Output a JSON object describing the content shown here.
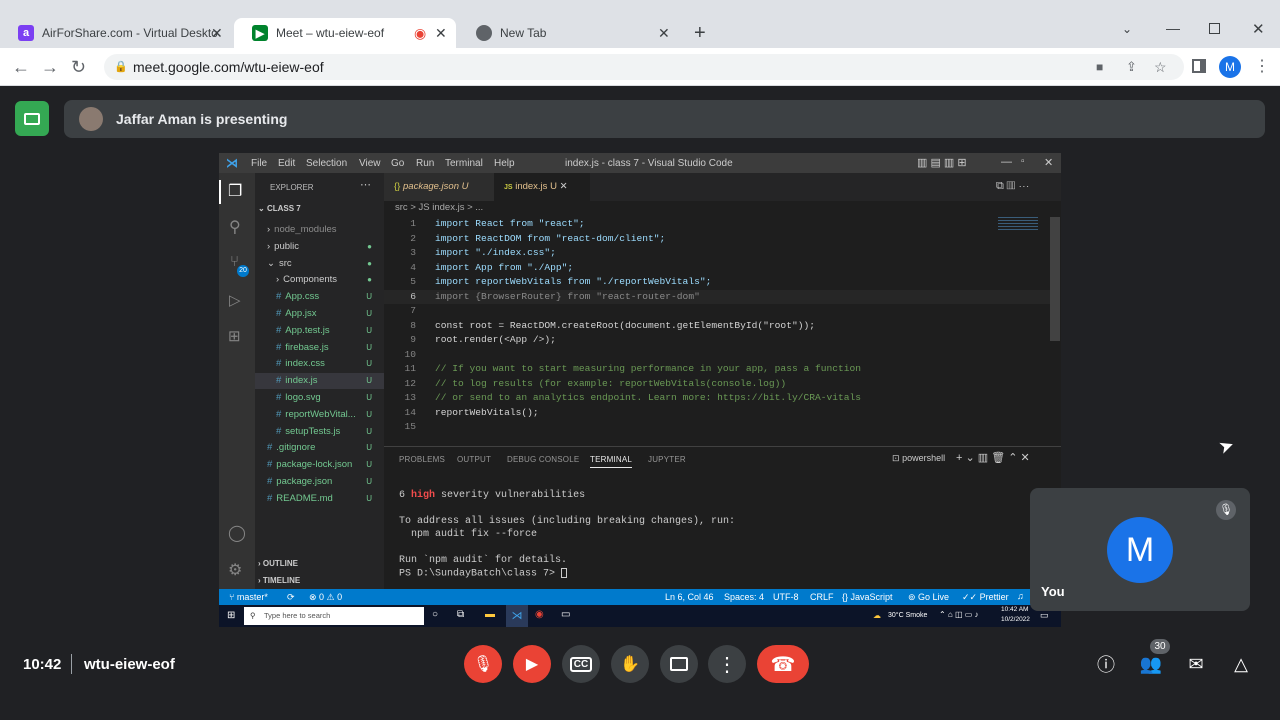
{
  "browser": {
    "tabs": [
      {
        "title": "AirForShare.com - Virtual Deskto",
        "icon": "airforshare-icon"
      },
      {
        "title": "Meet – wtu-eiew-eof",
        "icon": "meet-icon",
        "active": true
      },
      {
        "title": "New Tab",
        "icon": "chrome-icon"
      }
    ],
    "url": "meet.google.com/wtu-eiew-eof",
    "profile_initial": "M"
  },
  "meet": {
    "presenter_text": "Jaffar Aman is presenting",
    "clock": "10:42",
    "meeting_code": "wtu-eiew-eof",
    "you_label": "You",
    "you_initial": "M",
    "participants_count": "30",
    "colors": {
      "end_call": "#ea4335",
      "avatar": "#1a73e8",
      "present_icon_bg": "#34a853"
    }
  },
  "vscode": {
    "menu": [
      "File",
      "Edit",
      "Selection",
      "View",
      "Go",
      "Run",
      "Terminal",
      "Help"
    ],
    "window_title": "index.js - class 7 - Visual Studio Code",
    "explorer_header": "EXPLORER",
    "root_folder": "CLASS 7",
    "explorer": [
      {
        "name": "node_modules",
        "badge": ""
      },
      {
        "name": "public",
        "badge": "●"
      },
      {
        "name": "src",
        "badge": "●"
      },
      {
        "name": "Components",
        "badge": "●"
      },
      {
        "name": "App.css",
        "badge": "U"
      },
      {
        "name": "App.jsx",
        "badge": "U"
      },
      {
        "name": "App.test.js",
        "badge": "U"
      },
      {
        "name": "firebase.js",
        "badge": "U"
      },
      {
        "name": "index.css",
        "badge": "U"
      },
      {
        "name": "index.js",
        "badge": "U"
      },
      {
        "name": "logo.svg",
        "badge": "U"
      },
      {
        "name": "reportWebVital...",
        "badge": "U"
      },
      {
        "name": "setupTests.js",
        "badge": "U"
      },
      {
        "name": ".gitignore",
        "badge": "U"
      },
      {
        "name": "package-lock.json",
        "badge": "U"
      },
      {
        "name": "package.json",
        "badge": "U"
      },
      {
        "name": "README.md",
        "badge": "U"
      }
    ],
    "outline": "OUTLINE",
    "timeline": "TIMELINE",
    "editor_tabs": [
      {
        "label": "package.json",
        "mark": "U"
      },
      {
        "label": "index.js",
        "mark": "U"
      }
    ],
    "breadcrumb": [
      "src",
      ">",
      "JS index.js",
      "> ..."
    ],
    "code": [
      {
        "n": "1",
        "text": "import React from \"react\";"
      },
      {
        "n": "2",
        "text": "import ReactDOM from \"react-dom/client\";"
      },
      {
        "n": "3",
        "text": "import \"./index.css\";"
      },
      {
        "n": "4",
        "text": "import App from \"./App\";"
      },
      {
        "n": "5",
        "text": "import reportWebVitals from \"./reportWebVitals\";"
      },
      {
        "n": "6",
        "text": "import {BrowserRouter} from \"react-router-dom\""
      },
      {
        "n": "7",
        "text": ""
      },
      {
        "n": "8",
        "text": "const root = ReactDOM.createRoot(document.getElementById(\"root\"));"
      },
      {
        "n": "9",
        "text": "root.render(<App />);"
      },
      {
        "n": "10",
        "text": ""
      },
      {
        "n": "11",
        "text": "// If you want to start measuring performance in your app, pass a function"
      },
      {
        "n": "12",
        "text": "// to log results (for example: reportWebVitals(console.log))"
      },
      {
        "n": "13",
        "text": "// or send to an analytics endpoint. Learn more: https://bit.ly/CRA-vitals"
      },
      {
        "n": "14",
        "text": "reportWebVitals();"
      },
      {
        "n": "15",
        "text": ""
      }
    ],
    "panel_tabs": [
      "PROBLEMS",
      "OUTPUT",
      "DEBUG CONSOLE",
      "TERMINAL",
      "JUPYTER"
    ],
    "shell_label": "powershell",
    "terminal": {
      "vuln_count": "6",
      "vuln_level": "high",
      "vuln_rest": " severity vulnerabilities",
      "line2": "To address all issues (including breaking changes), run:",
      "line3": "  npm audit fix --force",
      "line4": "Run `npm audit` for details.",
      "prompt": "PS D:\\SundayBatch\\class 7> "
    },
    "status": {
      "branch": "master*",
      "problems": "⊗ 0 ⚠ 0",
      "position": "Ln 6, Col 46",
      "spaces": "Spaces: 4",
      "encoding": "UTF-8",
      "eol": "CRLF",
      "language": "{} JavaScript",
      "golive": "Go Live",
      "prettier": "Prettier"
    },
    "activity_badge": "20",
    "taskbar": {
      "search_placeholder": "Type here to search",
      "weather": "30°C Smoke",
      "time": "10:42 AM",
      "date": "10/2/2022"
    }
  }
}
